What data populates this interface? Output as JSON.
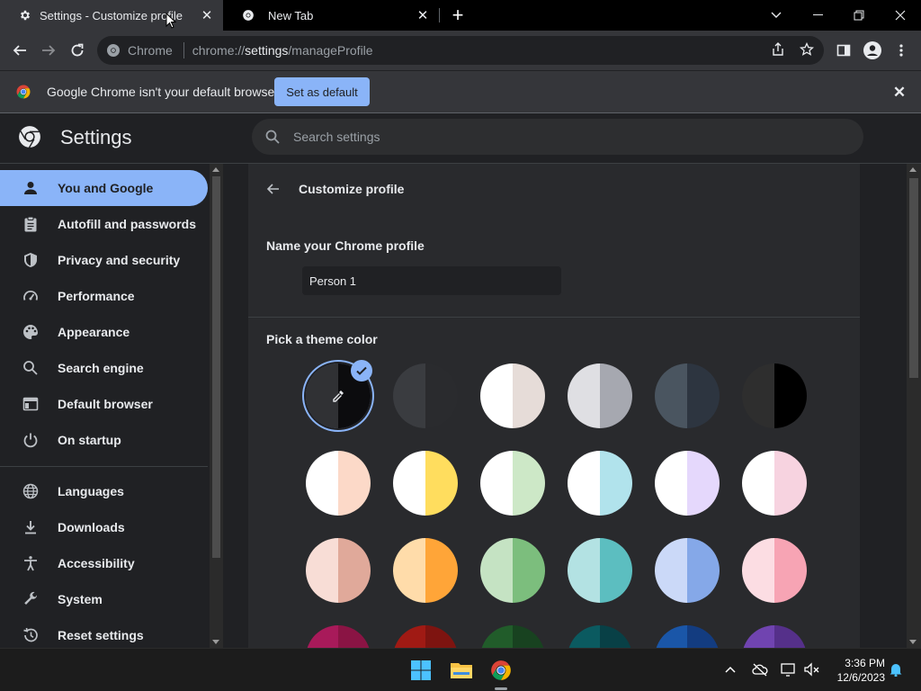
{
  "tabs": [
    {
      "title": "Settings - Customize profile",
      "active": true
    },
    {
      "title": "New Tab",
      "active": false
    }
  ],
  "omnibox": {
    "chip": "Chrome",
    "url_prefix": "chrome://",
    "url_host": "settings",
    "url_path": "/manageProfile"
  },
  "infobar": {
    "message": "Google Chrome isn't your default browser",
    "button": "Set as default"
  },
  "header": {
    "title": "Settings",
    "search_placeholder": "Search settings"
  },
  "sidebar": {
    "items": [
      {
        "label": "You and Google",
        "icon": "person-icon",
        "selected": true
      },
      {
        "label": "Autofill and passwords",
        "icon": "clipboard-icon"
      },
      {
        "label": "Privacy and security",
        "icon": "shield-icon"
      },
      {
        "label": "Performance",
        "icon": "speedometer-icon"
      },
      {
        "label": "Appearance",
        "icon": "palette-icon"
      },
      {
        "label": "Search engine",
        "icon": "search-icon"
      },
      {
        "label": "Default browser",
        "icon": "browser-window-icon"
      },
      {
        "label": "On startup",
        "icon": "power-icon"
      },
      {
        "label": "Languages",
        "icon": "globe-icon"
      },
      {
        "label": "Downloads",
        "icon": "download-icon"
      },
      {
        "label": "Accessibility",
        "icon": "accessibility-icon"
      },
      {
        "label": "System",
        "icon": "wrench-icon"
      },
      {
        "label": "Reset settings",
        "icon": "history-icon"
      }
    ]
  },
  "customize": {
    "title": "Customize profile",
    "name_label": "Name your Chrome profile",
    "name_value": "Person 1",
    "theme_label": "Pick a theme color",
    "swatches": [
      {
        "left": "#303134",
        "right": "#0c0c0e",
        "selected": true,
        "custom": true
      },
      {
        "left": "#3a3c40",
        "right": "#2a2b2e"
      },
      {
        "left": "#ffffff",
        "right": "#e6dcd8"
      },
      {
        "left": "#dfdfe3",
        "right": "#a6a8b0"
      },
      {
        "left": "#4a5560",
        "right": "#2d3540"
      },
      {
        "left": "#2e2e2e",
        "right": "#000000"
      },
      {
        "left": "#ffffff",
        "right": "#fcd9c8"
      },
      {
        "left": "#ffffff",
        "right": "#ffdd5e"
      },
      {
        "left": "#ffffff",
        "right": "#cde8c7"
      },
      {
        "left": "#ffffff",
        "right": "#b1e3ec"
      },
      {
        "left": "#ffffff",
        "right": "#e5d8fc"
      },
      {
        "left": "#ffffff",
        "right": "#f7d3e0"
      },
      {
        "left": "#f8ddd6",
        "right": "#e0a99a"
      },
      {
        "left": "#ffdcaa",
        "right": "#ffa538"
      },
      {
        "left": "#c5e3c3",
        "right": "#7cbe7d"
      },
      {
        "left": "#b3e2e3",
        "right": "#5cbec0"
      },
      {
        "left": "#cbd9f8",
        "right": "#85a8e8"
      },
      {
        "left": "#fcdde3",
        "right": "#f7a4b4"
      },
      {
        "left": "#a81a5a",
        "right": "#8a1444"
      },
      {
        "left": "#a01a14",
        "right": "#7e1410"
      },
      {
        "left": "#215c2a",
        "right": "#184220"
      },
      {
        "left": "#0b5a60",
        "right": "#084046"
      },
      {
        "left": "#1a56a8",
        "right": "#133c80"
      },
      {
        "left": "#7044b0",
        "right": "#55308a"
      }
    ]
  },
  "taskbar": {
    "time": "3:36 PM",
    "date": "12/6/2023"
  }
}
